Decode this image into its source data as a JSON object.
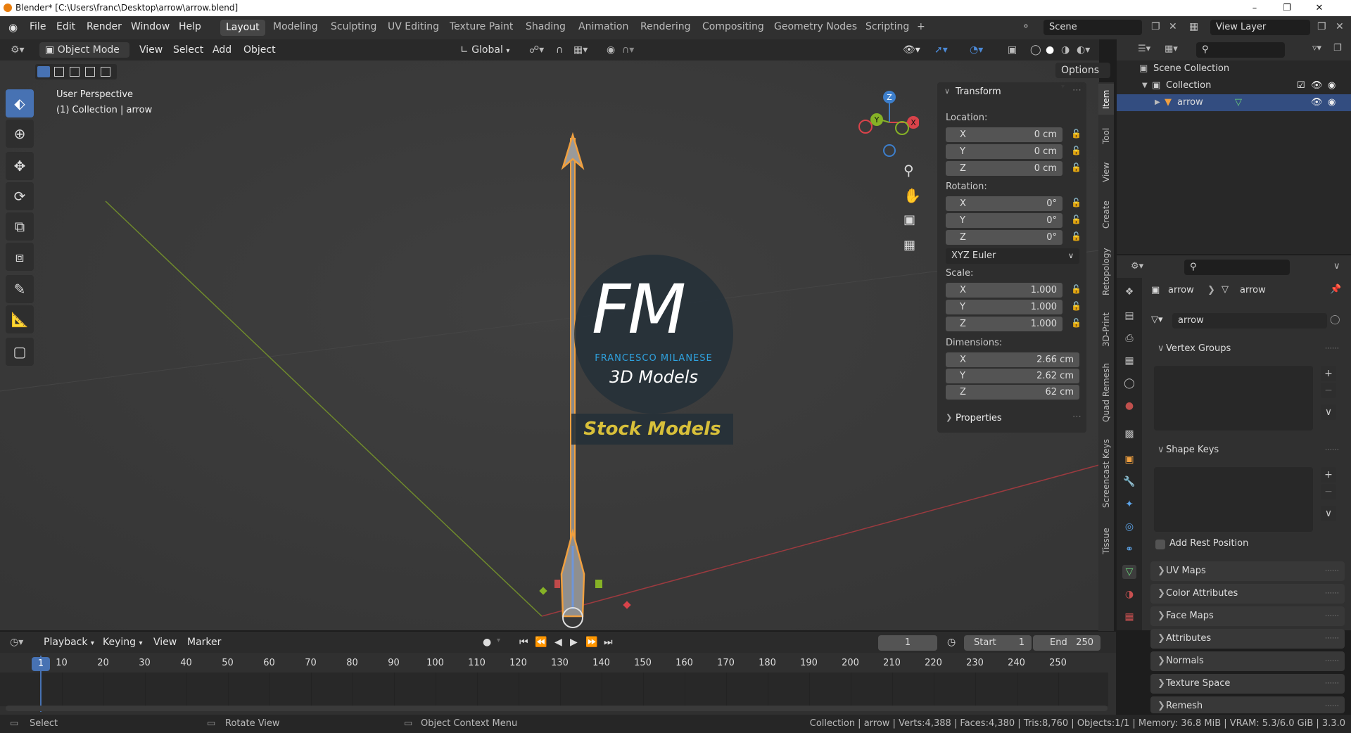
{
  "window": {
    "title": "Blender* [C:\\Users\\franc\\Desktop\\arrow\\arrow.blend]"
  },
  "menus": [
    "File",
    "Edit",
    "Render",
    "Window",
    "Help"
  ],
  "workspaces": [
    "Layout",
    "Modeling",
    "Sculpting",
    "UV Editing",
    "Texture Paint",
    "Shading",
    "Animation",
    "Rendering",
    "Compositing",
    "Geometry Nodes",
    "Scripting"
  ],
  "active_workspace": "Layout",
  "add_workspace": "+",
  "scene": "Scene",
  "view_layer": "View Layer",
  "viewport": {
    "mode": "Object Mode",
    "menus": [
      "View",
      "Select",
      "Add",
      "Object"
    ],
    "orientation": "Global",
    "options": "Options",
    "label_line1": "User Perspective",
    "label_line2": "(1) Collection | arrow",
    "gizmo_axes": [
      "Z",
      "Y",
      "X"
    ]
  },
  "watermark": {
    "logo": "FM",
    "brand": "FRANCESCO MILANESE",
    "sub": "3D Models",
    "banner": "Stock Models"
  },
  "npanel": {
    "transform": "Transform",
    "location_label": "Location:",
    "location": [
      {
        "axis": "X",
        "value": "0 cm"
      },
      {
        "axis": "Y",
        "value": "0 cm"
      },
      {
        "axis": "Z",
        "value": "0 cm"
      }
    ],
    "rotation_label": "Rotation:",
    "rotation": [
      {
        "axis": "X",
        "value": "0°"
      },
      {
        "axis": "Y",
        "value": "0°"
      },
      {
        "axis": "Z",
        "value": "0°"
      }
    ],
    "rotation_mode": "XYZ Euler",
    "scale_label": "Scale:",
    "scale": [
      {
        "axis": "X",
        "value": "1.000"
      },
      {
        "axis": "Y",
        "value": "1.000"
      },
      {
        "axis": "Z",
        "value": "1.000"
      }
    ],
    "dimensions_label": "Dimensions:",
    "dimensions": [
      {
        "axis": "X",
        "value": "2.66 cm"
      },
      {
        "axis": "Y",
        "value": "2.62 cm"
      },
      {
        "axis": "Z",
        "value": "62 cm"
      }
    ],
    "properties": "Properties"
  },
  "side_tabs": [
    "Item",
    "Tool",
    "View",
    "Create",
    "Retopology",
    "3D-Print",
    "Quad Remesh",
    "Screencast Keys",
    "Tissue"
  ],
  "outliner": {
    "scene_collection": "Scene Collection",
    "collection": "Collection",
    "object": "arrow"
  },
  "properties": {
    "breadcrumb_object": "arrow",
    "breadcrumb_data": "arrow",
    "data_name": "arrow",
    "vertex_groups": "Vertex Groups",
    "shape_keys": "Shape Keys",
    "add_rest_position": "Add Rest Position",
    "panels": [
      "UV Maps",
      "Color Attributes",
      "Face Maps",
      "Attributes",
      "Normals",
      "Texture Space",
      "Remesh"
    ]
  },
  "timeline": {
    "menus": [
      "Playback",
      "Keying",
      "View",
      "Marker"
    ],
    "current_frame": "1",
    "start_label": "Start",
    "start": "1",
    "end_label": "End",
    "end": "250",
    "ruler": [
      "1",
      "10",
      "20",
      "30",
      "40",
      "50",
      "60",
      "70",
      "80",
      "90",
      "100",
      "110",
      "120",
      "130",
      "140",
      "150",
      "160",
      "170",
      "180",
      "190",
      "200",
      "210",
      "220",
      "230",
      "240",
      "250"
    ]
  },
  "status": {
    "select": "Select",
    "rotate": "Rotate View",
    "context": "Object Context Menu",
    "stats": "Collection | arrow | Verts:4,388 | Faces:4,380 | Tris:8,760 | Objects:1/1 | Memory: 36.8 MiB | VRAM: 5.3/6.0 GiB | 3.3.0"
  },
  "colors": {
    "accent": "#4772b3",
    "selection_orange": "#f0a040",
    "x_axis": "#d9434a",
    "y_axis": "#86b226",
    "z_axis": "#3d7fcc"
  }
}
